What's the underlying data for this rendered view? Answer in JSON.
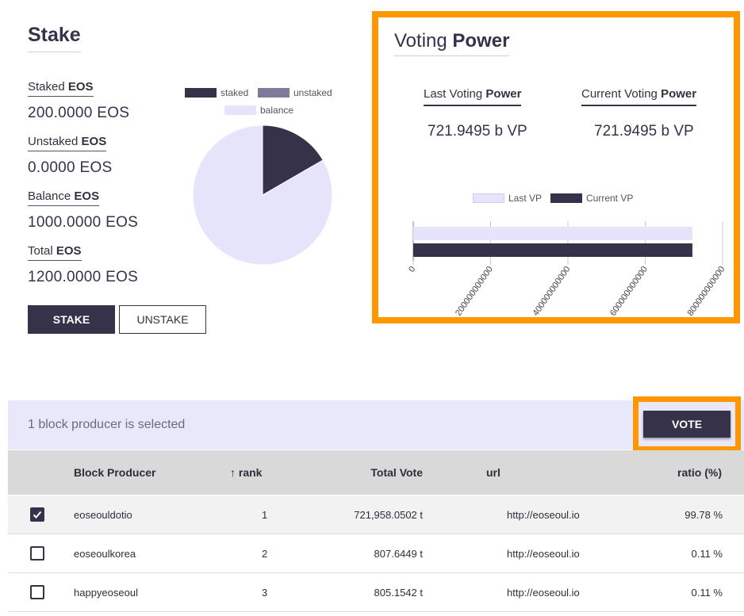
{
  "stake": {
    "title": "Stake",
    "staked_label": "Staked",
    "staked_value": "200.0000 EOS",
    "unstaked_label": "Unstaked",
    "unstaked_value": "0.0000 EOS",
    "balance_label": "Balance",
    "balance_value": "1000.0000 EOS",
    "total_label": "Total",
    "total_value": "1200.0000 EOS",
    "unit": "EOS",
    "stake_button": "STAKE",
    "unstake_button": "UNSTAKE",
    "pie_legend": [
      {
        "label": "staked",
        "color": "#35324a"
      },
      {
        "label": "unstaked",
        "color": "#7e7a9a"
      },
      {
        "label": "balance",
        "color": "#e6e4fb"
      }
    ]
  },
  "voting_power": {
    "title_regular": "Voting",
    "title_bold": "Power",
    "last_label": "Last Voting",
    "current_label": "Current Voting",
    "power_word": "Power",
    "last_value": "721.9495 b VP",
    "current_value": "721.9495 b VP",
    "bar_legend": [
      {
        "label": "Last VP",
        "color": "#e6e4fb"
      },
      {
        "label": "Current VP",
        "color": "#35324a"
      }
    ]
  },
  "chart_data": [
    {
      "type": "pie",
      "categories": [
        "staked",
        "unstaked",
        "balance"
      ],
      "values": [
        200,
        0,
        1000
      ],
      "colors": [
        "#35324a",
        "#7e7a9a",
        "#e6e4fb"
      ],
      "legend": "top"
    },
    {
      "type": "bar",
      "orientation": "horizontal",
      "series": [
        {
          "name": "Last VP",
          "values": [
            721949500000
          ],
          "color": "#e6e4fb"
        },
        {
          "name": "Current VP",
          "values": [
            721949500000
          ],
          "color": "#35324a"
        }
      ],
      "xlim": [
        0,
        800000000000
      ],
      "xticks": [
        "0",
        "200000000000",
        "400000000000",
        "600000000000",
        "800000000000"
      ],
      "grid": true,
      "legend": "top"
    }
  ],
  "selection": {
    "text": "1 block producer is selected",
    "vote_button": "VOTE"
  },
  "table": {
    "headers": {
      "producer": "Block Producer",
      "rank_arrow": "↑",
      "rank": "rank",
      "total_vote": "Total Vote",
      "url": "url",
      "ratio": "ratio (%)"
    },
    "rows": [
      {
        "checked": true,
        "producer": "eoseouldotio",
        "rank": "1",
        "total_vote": "721,958.0502 t",
        "url": "http://eoseoul.io",
        "ratio": "99.78 %"
      },
      {
        "checked": false,
        "producer": "eoseoulkorea",
        "rank": "2",
        "total_vote": "807.6449 t",
        "url": "http://eoseoul.io",
        "ratio": "0.11 %"
      },
      {
        "checked": false,
        "producer": "happyeoseoul",
        "rank": "3",
        "total_vote": "805.1542 t",
        "url": "http://eoseoul.io",
        "ratio": "0.11 %"
      }
    ]
  }
}
